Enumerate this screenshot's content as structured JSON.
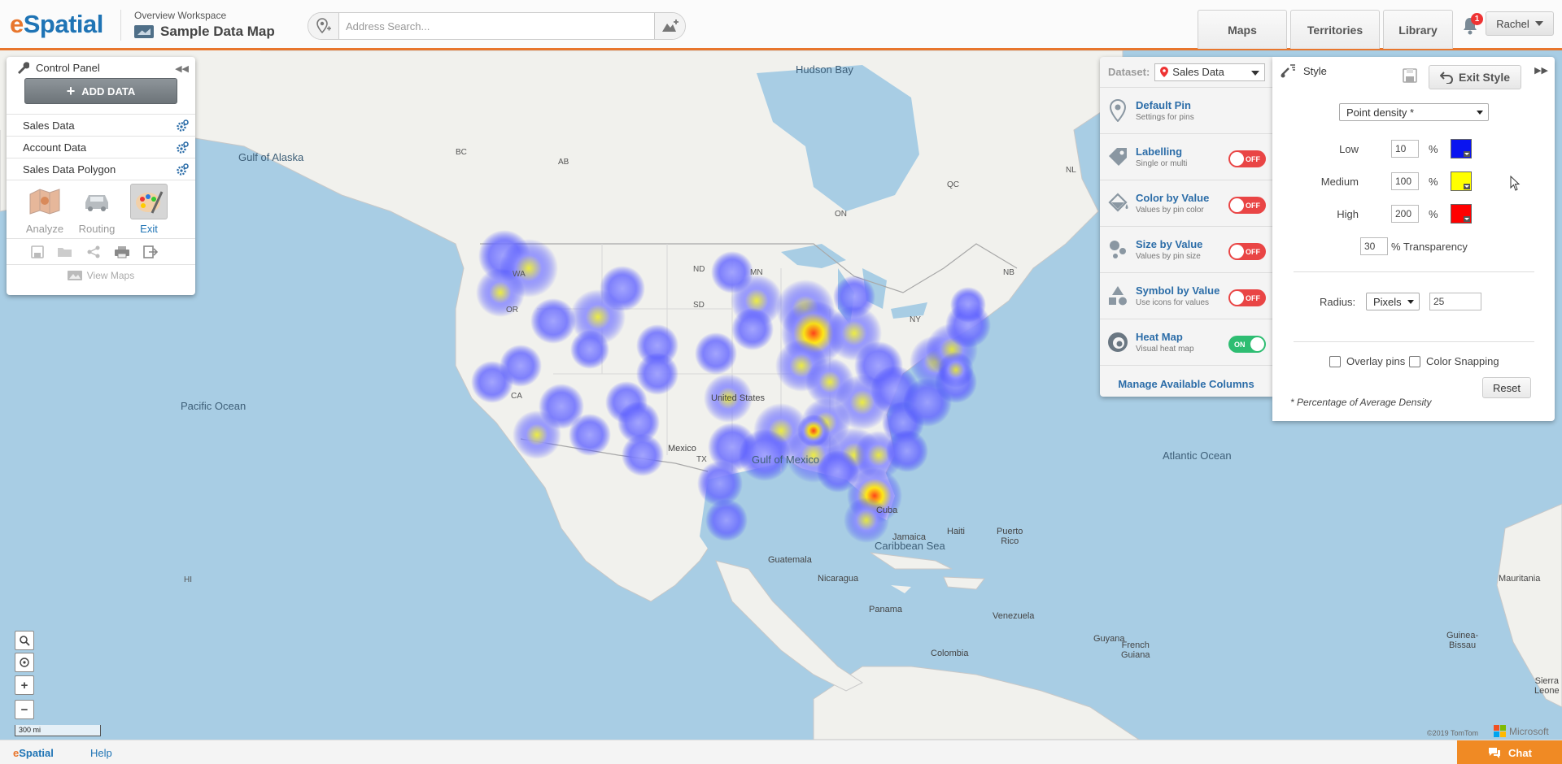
{
  "header": {
    "logo_e": "e",
    "logo_rest": "Spatial",
    "workspace_subtitle": "Overview Workspace",
    "workspace_title": "Sample Data Map",
    "search_placeholder": "Address Search...",
    "nav": {
      "maps": "Maps",
      "territories": "Territories",
      "library": "Library"
    },
    "notification_count": "1",
    "user_name": "Rachel"
  },
  "control_panel": {
    "title": "Control Panel",
    "add_data_label": "ADD DATA",
    "layers": [
      "Sales Data",
      "Account Data",
      "Sales Data Polygon"
    ],
    "tools": {
      "analyze": "Analyze",
      "routing": "Routing",
      "exit": "Exit"
    },
    "view_maps_label": "View Maps"
  },
  "dataset_panel": {
    "dataset_label": "Dataset:",
    "dataset_value": "Sales Data",
    "rows": [
      {
        "title": "Default Pin",
        "subtitle": "Settings for pins",
        "toggle": ""
      },
      {
        "title": "Labelling",
        "subtitle": "Single or multi",
        "toggle": "OFF"
      },
      {
        "title": "Color by Value",
        "subtitle": "Values by pin color",
        "toggle": "OFF"
      },
      {
        "title": "Size by Value",
        "subtitle": "Values by pin size",
        "toggle": "OFF"
      },
      {
        "title": "Symbol by Value",
        "subtitle": "Use icons for values",
        "toggle": "OFF"
      },
      {
        "title": "Heat Map",
        "subtitle": "Visual heat map",
        "toggle": "ON"
      }
    ],
    "manage_columns_label": "Manage Available Columns"
  },
  "style_panel": {
    "title": "Style",
    "exit_style_label": "Exit Style",
    "mode_value": "Point density *",
    "levels": [
      {
        "label": "Low",
        "value": "10",
        "unit": "%",
        "color": "#0a14f0"
      },
      {
        "label": "Medium",
        "value": "100",
        "unit": "%",
        "color": "#ffff00"
      },
      {
        "label": "High",
        "value": "200",
        "unit": "%",
        "color": "#ff0000"
      }
    ],
    "transparency_value": "30",
    "transparency_label": "% Transparency",
    "radius_label": "Radius:",
    "radius_unit": "Pixels",
    "radius_value": "25",
    "overlay_pins_label": "Overlay pins",
    "color_snapping_label": "Color Snapping",
    "reset_label": "Reset",
    "footnote": "* Percentage of Average Density"
  },
  "map": {
    "labels": {
      "hudson_bay": "Hudson Bay",
      "gulf_alaska": "Gulf of Alaska",
      "pacific": "Pacific Ocean",
      "atlantic": "Atlantic Ocean",
      "gulf_mexico": "Gulf of Mexico",
      "caribbean": "Caribbean Sea",
      "mexico": "Mexico",
      "cuba": "Cuba",
      "jamaica": "Jamaica",
      "haiti": "Haiti",
      "puerto_rico": "Puerto\nRico",
      "guatemala": "Guatemala",
      "nicaragua": "Nicaragua",
      "panama": "Panama",
      "venezuela": "Venezuela",
      "guyana": "Guyana",
      "colombia": "Colombia",
      "french_guiana": "French\nGuiana",
      "mauritania": "Mauritania",
      "guinea_bissau": "Guinea-\nBissau",
      "sierra_leone": "Sierra\nLeone",
      "united_states": "United States",
      "bc": "BC",
      "ab": "AB",
      "qc": "QC",
      "on": "ON",
      "nl": "NL",
      "nb": "NB",
      "wa": "WA",
      "or": "OR",
      "ca": "CA",
      "nd": "ND",
      "mn": "MN",
      "sd": "SD",
      "ny": "NY",
      "tx": "TX",
      "hi": "HI"
    },
    "scale_label": "300 mi",
    "copyright": "©2019 TomTom",
    "ms_label": "Microsoft"
  },
  "footer": {
    "logo_e": "e",
    "logo_rest": "Spatial",
    "help_label": "Help",
    "chat_label": "Chat"
  },
  "colors": {
    "brand_orange": "#e8762d",
    "brand_blue": "#1f74b5",
    "water": "#a8cde4",
    "land": "#f1f1ed"
  }
}
